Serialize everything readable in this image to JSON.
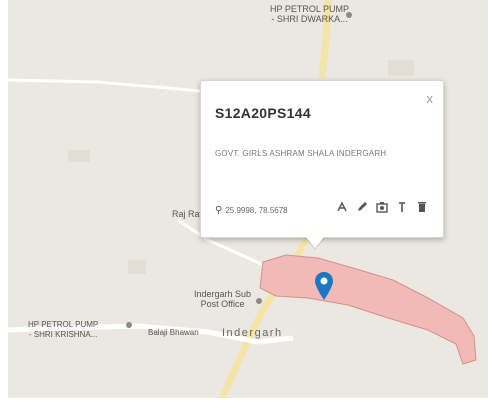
{
  "map": {
    "places": {
      "petrol_top": "HP PETROL PUMP\n- SHRI DWARKA...",
      "raj_ray": "Raj Ray",
      "indergarh_sub_po": "Indergarh Sub\nPost Office",
      "petrol_bottom": "HP PETROL PUMP\n- SHRI KRISHNA...",
      "balaji_bhawan": "Balaji Bhawan",
      "indergarh": "Indergarh"
    },
    "region_color": "#f2b8b4",
    "road_color": "#f3e4a8",
    "marker_color": "#1a78c2"
  },
  "popup": {
    "title": "S12A20PS144",
    "description": "GOVT. GIRLS ASHRAM SHALA INDERGARH",
    "coordinates": "25.9998, 78.5678",
    "close_label": "x",
    "tools": [
      "measure-icon",
      "edit-icon",
      "camera-icon",
      "info-icon",
      "delete-icon"
    ]
  }
}
